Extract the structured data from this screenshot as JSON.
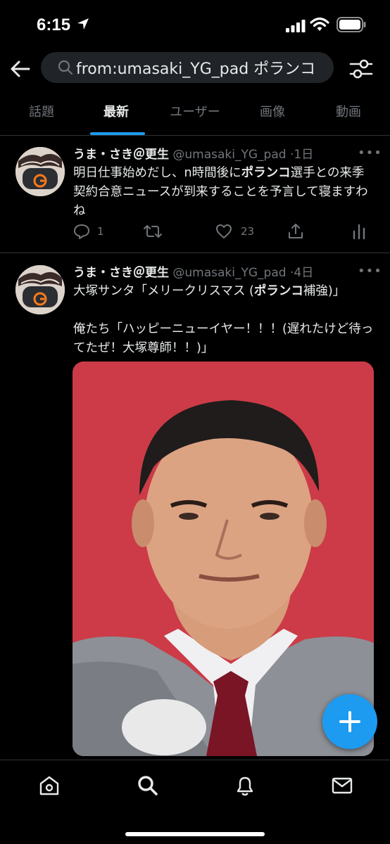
{
  "status_bar": {
    "time": "6:15"
  },
  "search": {
    "query": "from:umasaki_YG_pad ポランコ"
  },
  "tabs": [
    {
      "label": "話題"
    },
    {
      "label": "最新"
    },
    {
      "label": "ユーザー"
    },
    {
      "label": "画像"
    },
    {
      "label": "動画"
    }
  ],
  "active_tab": "最新",
  "tweets": [
    {
      "name": "うま・さき＠更生",
      "handle": "@umasaki_YG_pad",
      "sep": "·",
      "time": "1日",
      "body": {
        "p1": "明日仕事始めだし、n時間後に",
        "hl": "ポランコ",
        "p2": "選手との来季契約合意ニュースが到来することを予言して寝ますわね"
      },
      "replies": "1",
      "retweets": "",
      "likes": "23"
    },
    {
      "name": "うま・さき＠更生",
      "handle": "@umasaki_YG_pad",
      "sep": "·",
      "time": "4日",
      "body": {
        "p1": "大塚サンタ「メリークリスマス (",
        "hl": "ポランコ",
        "p2": "補強)」",
        "p3": "俺たち「ハッピーニューイヤー！！！(遅れたけど待ってたぜ！大塚尊師！！)」"
      }
    }
  ],
  "colors": {
    "accent": "#1d9bf0",
    "background": "#000000",
    "muted": "#71767b"
  },
  "icons": [
    "location-arrow-icon",
    "signal-icon",
    "wifi-icon",
    "battery-icon",
    "back-arrow-icon",
    "search-icon",
    "filter-icon",
    "reply-icon",
    "retweet-icon",
    "like-icon",
    "share-icon",
    "analytics-icon",
    "compose-icon",
    "home-icon",
    "explore-icon",
    "notifications-icon",
    "messages-icon"
  ]
}
